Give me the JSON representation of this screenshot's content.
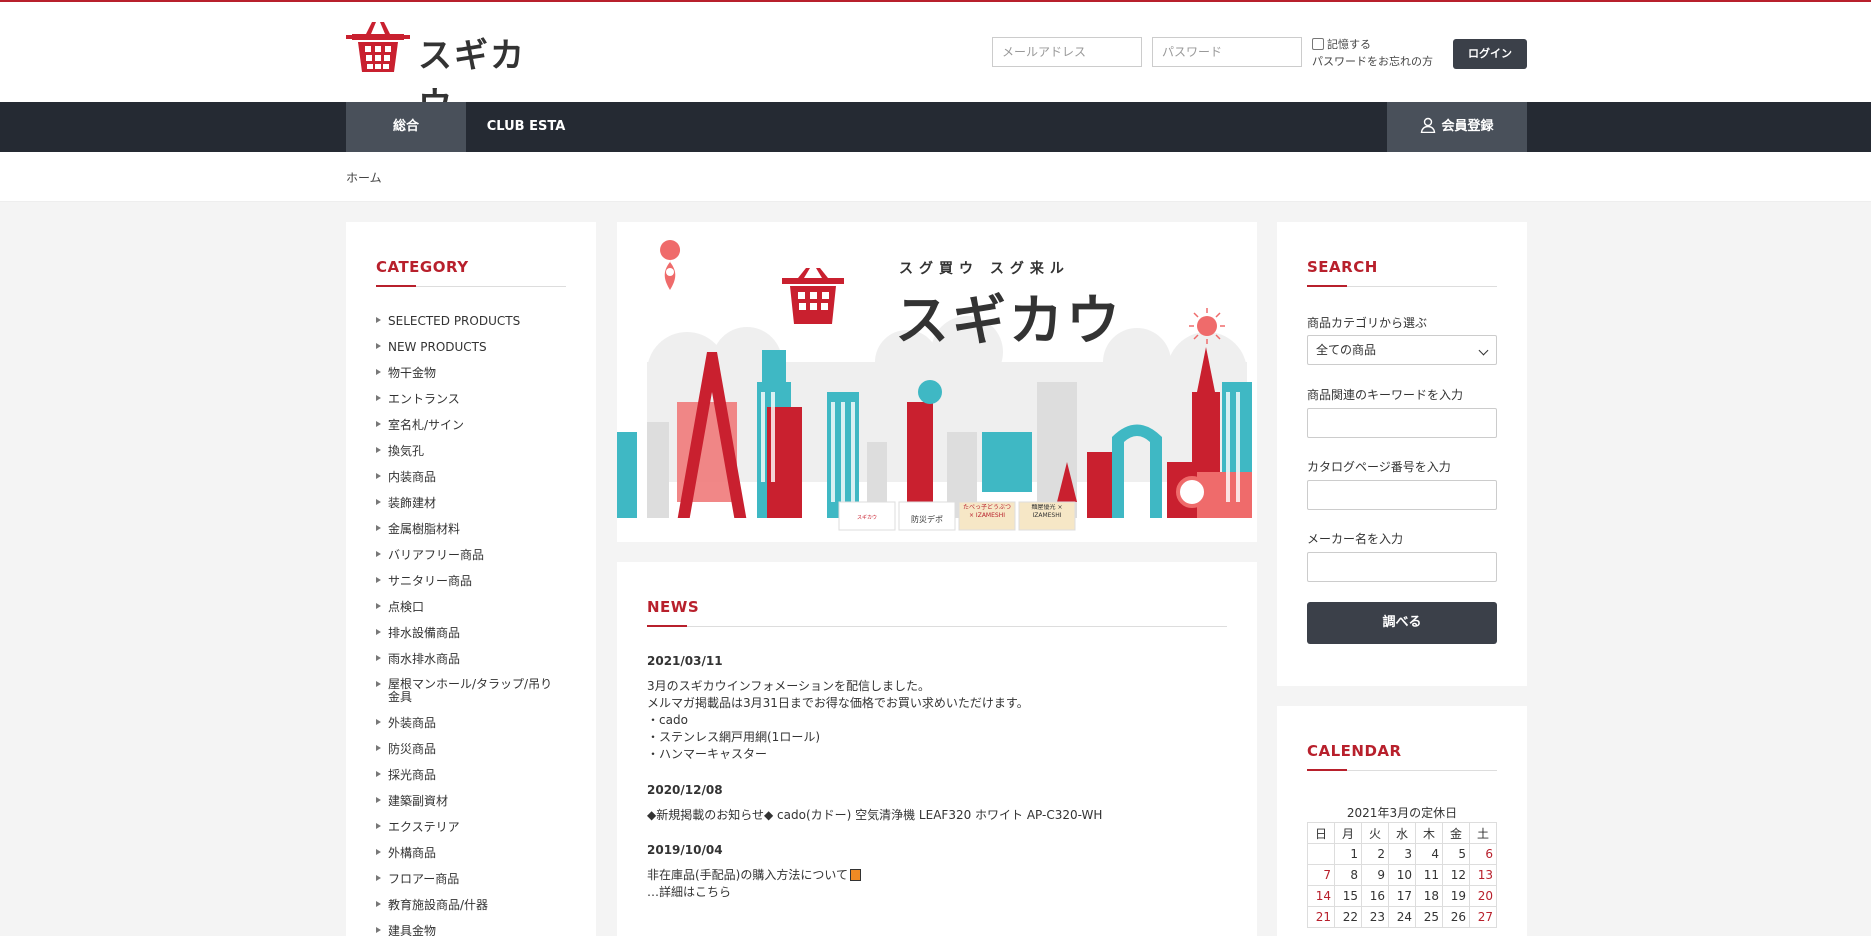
{
  "brand": {
    "name": "スギカウ",
    "accent_color": "#b8202c",
    "dark_color": "#252a33"
  },
  "header": {
    "email_placeholder": "メールアドレス",
    "password_placeholder": "パスワード",
    "remember_label": "記憶する",
    "forgot_label": "パスワードをお忘れの方",
    "login_label": "ログイン"
  },
  "nav": {
    "tabs": [
      {
        "label": "総合",
        "active": true
      },
      {
        "label": "CLUB ESTA",
        "active": false
      }
    ],
    "register_label": "会員登録",
    "register_icon": "user-icon"
  },
  "breadcrumb": {
    "home": "ホーム"
  },
  "category": {
    "title": "CATEGORY",
    "items": [
      "SELECTED PRODUCTS",
      "NEW PRODUCTS",
      "物干金物",
      "エントランス",
      "室名札/サイン",
      "換気孔",
      "内装商品",
      "装飾建材",
      "金属樹脂材料",
      "バリアフリー商品",
      "サニタリー商品",
      "点検口",
      "排水設備商品",
      "雨水排水商品",
      "屋根マンホール/タラップ/吊り金具",
      "外装商品",
      "防災商品",
      "採光商品",
      "建築副資材",
      "エクステリア",
      "外構商品",
      "フロアー商品",
      "教育施設商品/什器",
      "建具金物"
    ]
  },
  "hero": {
    "tagline": "スグ買ウ スグ来ル",
    "brand": "スギカウ",
    "banner_labels": [
      "スギカウ",
      "防災デポ",
      "たべっ子どうぶつ × IZAMESHI",
      "麺屋優光 × IZAMESHI"
    ]
  },
  "news": {
    "title": "NEWS",
    "entries": [
      {
        "date": "2021/03/11",
        "lines": [
          "3月のスギカウインフォメーションを配信しました。",
          "メルマガ掲載品は3月31日までお得な価格でお買い求めいただけます。",
          "・cado",
          "・ステンレス網戸用網(1ロール)",
          "・ハンマーキャスター"
        ]
      },
      {
        "date": "2020/12/08",
        "lines": [
          "◆新規掲載のお知らせ◆ cado(カドー) 空気清浄機 LEAF320 ホワイト AP-C320-WH"
        ]
      },
      {
        "date": "2019/10/04",
        "lines": [
          "非在庫品(手配品)の購入方法について",
          "…詳細はこちら"
        ]
      }
    ]
  },
  "search": {
    "title": "SEARCH",
    "category_label": "商品カテゴリから選ぶ",
    "category_selected": "全ての商品",
    "keyword_label": "商品関連のキーワードを入力",
    "catalog_label": "カタログページ番号を入力",
    "maker_label": "メーカー名を入力",
    "submit_label": "調べる"
  },
  "calendar": {
    "title": "CALENDAR",
    "caption": "2021年3月の定休日",
    "weekdays": [
      "日",
      "月",
      "火",
      "水",
      "木",
      "金",
      "土"
    ],
    "weeks": [
      [
        "",
        "1",
        "2",
        "3",
        "4",
        "5",
        "6"
      ],
      [
        "7",
        "8",
        "9",
        "10",
        "11",
        "12",
        "13"
      ],
      [
        "14",
        "15",
        "16",
        "17",
        "18",
        "19",
        "20"
      ],
      [
        "21",
        "22",
        "23",
        "24",
        "25",
        "26",
        "27"
      ]
    ],
    "holidays": [
      "6",
      "7",
      "13",
      "14",
      "20",
      "21",
      "27"
    ]
  }
}
